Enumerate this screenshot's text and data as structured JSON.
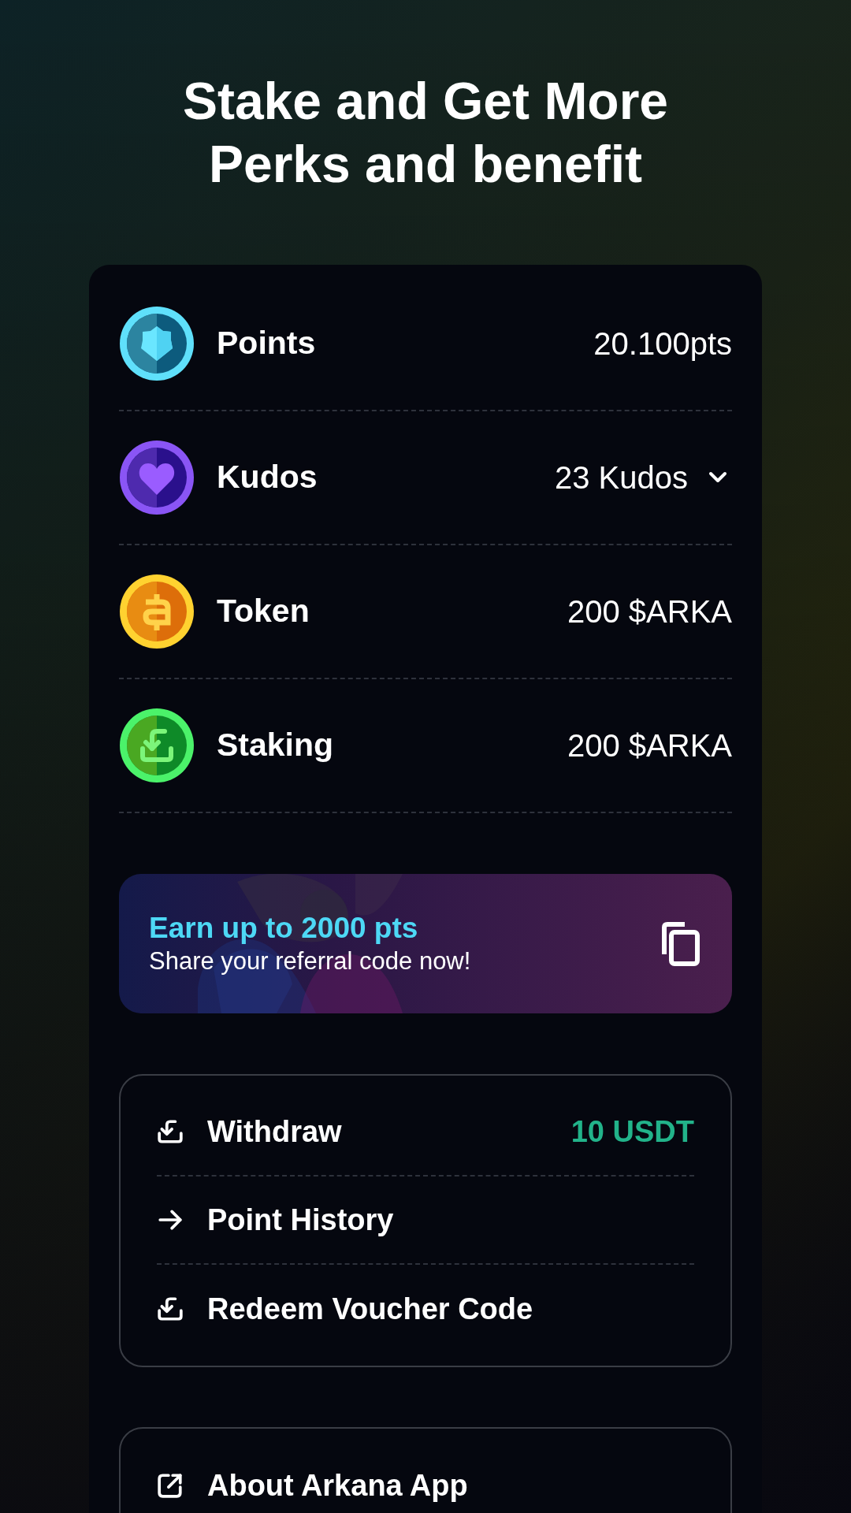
{
  "title": "Stake and Get More Perks and benefit",
  "balances": [
    {
      "kind": "points",
      "label": "Points",
      "value": "20.100pts",
      "dropdown": false
    },
    {
      "kind": "kudos",
      "label": "Kudos",
      "value": "23 Kudos",
      "dropdown": true
    },
    {
      "kind": "token",
      "label": "Token",
      "value": "200 $ARKA",
      "dropdown": false
    },
    {
      "kind": "staking",
      "label": "Staking",
      "value": "200 $ARKA",
      "dropdown": false
    }
  ],
  "referral": {
    "headline": "Earn up to 2000 pts",
    "subtitle": "Share your referral code now!"
  },
  "menu": [
    {
      "kind": "tray",
      "label": "Withdraw",
      "value": "10 USDT"
    },
    {
      "kind": "arrow",
      "label": "Point History"
    },
    {
      "kind": "tray",
      "label": "Redeem Voucher Code"
    }
  ],
  "menu_2": [
    {
      "kind": "external",
      "label": "About Arkana App"
    }
  ]
}
